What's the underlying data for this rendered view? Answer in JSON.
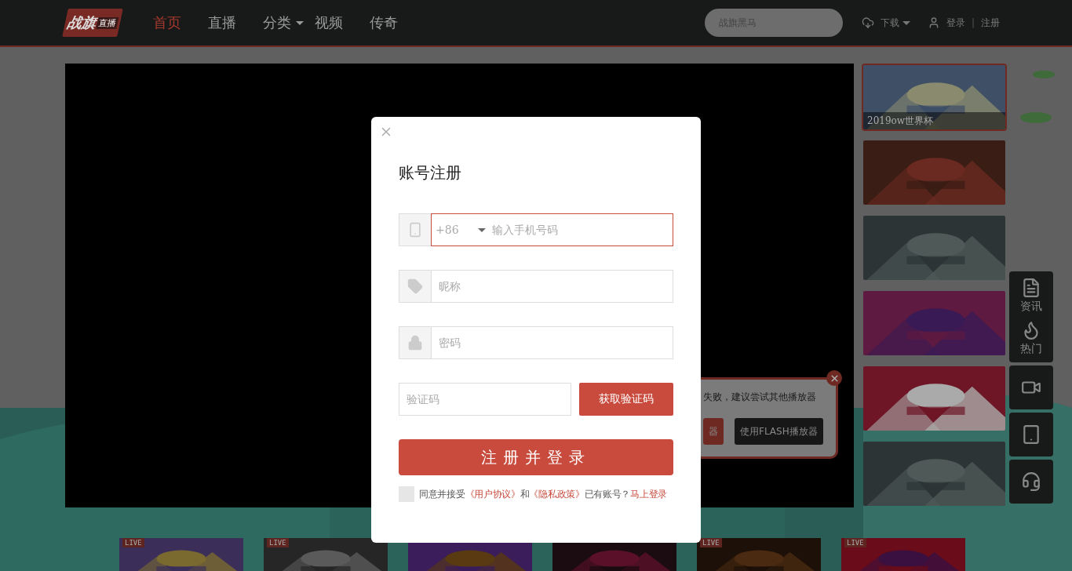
{
  "header": {
    "logo": {
      "name": "战旗",
      "tag": "直播"
    },
    "nav": [
      {
        "label": "首页",
        "selected": true,
        "dropdown": false
      },
      {
        "label": "直播",
        "selected": false,
        "dropdown": false
      },
      {
        "label": "分类",
        "selected": false,
        "dropdown": true
      },
      {
        "label": "视频",
        "selected": false,
        "dropdown": false
      },
      {
        "label": "传奇",
        "selected": false,
        "dropdown": false
      }
    ],
    "search": {
      "placeholder": "战旗黑马"
    },
    "download": "下载",
    "login": "登录",
    "separator": "|",
    "register": "注册"
  },
  "player": {
    "popup": {
      "message": "失败，建议尝试其他播放器",
      "buttons": [
        {
          "label": "器",
          "kind": "primary"
        },
        {
          "label": "使用FLASH播放器",
          "kind": "dark"
        }
      ]
    }
  },
  "featured": [
    {
      "caption": "2019ow世界杯",
      "selected": true
    },
    {
      "selected": false
    },
    {
      "selected": false
    },
    {
      "selected": false
    },
    {
      "selected": false
    },
    {
      "selected": false
    }
  ],
  "tools": [
    {
      "items": [
        {
          "kind": "news",
          "label": "资讯"
        },
        {
          "kind": "hot",
          "label": "热门"
        }
      ]
    },
    {
      "items": [
        {
          "kind": "video"
        }
      ]
    },
    {
      "items": [
        {
          "kind": "mobile"
        }
      ]
    },
    {
      "items": [
        {
          "kind": "support"
        }
      ]
    }
  ],
  "live_cards": [
    {
      "kind": "picture",
      "badge": "LIVE"
    },
    {
      "kind": "picture",
      "badge": "LIVE"
    },
    {
      "kind": "picture"
    },
    {
      "kind": "picture"
    },
    {
      "kind": "picture",
      "badge": "LIVE"
    },
    {
      "kind": "picture",
      "badge": "LIVE"
    }
  ],
  "modal": {
    "title": "账号注册",
    "fields": [
      {
        "kind": "phone",
        "prefix": "+86",
        "placeholder": "输入手机号码",
        "focused": true
      },
      {
        "kind": "nickname",
        "placeholder": "昵称",
        "focused": false
      },
      {
        "kind": "password",
        "placeholder": "密码",
        "focused": false
      }
    ],
    "code": {
      "placeholder": "验证码",
      "button": "获取验证码"
    },
    "submit": "注册并登录",
    "agreement": {
      "checked": false,
      "intro": "同意并接受",
      "terms_link": "《用户协议》",
      "and": "和",
      "privacy_link": "《隐私政策》",
      "has_account": "已有账号？",
      "login_link": "马上登录"
    }
  }
}
